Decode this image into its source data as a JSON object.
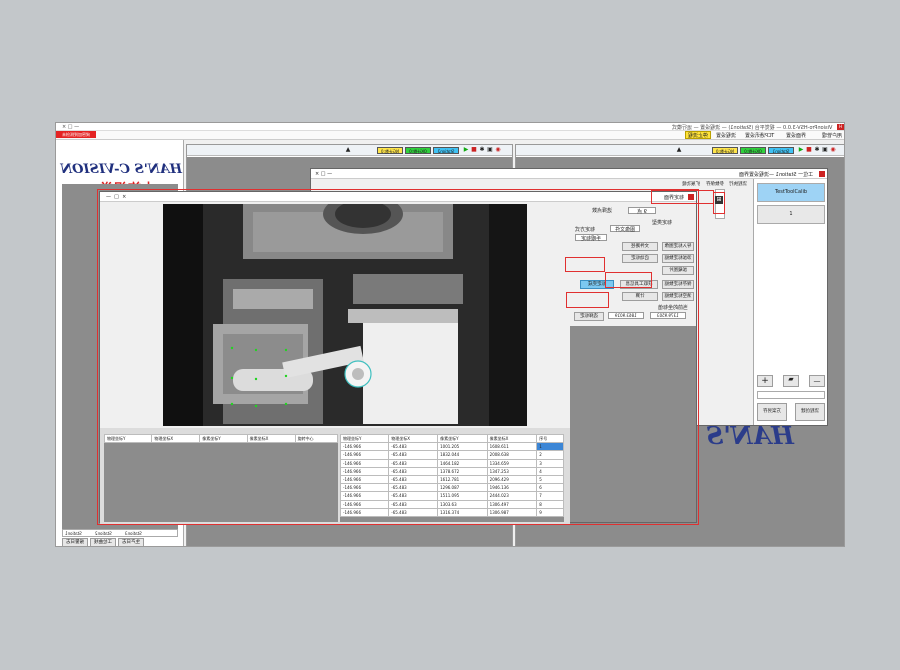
{
  "app": {
    "title": "VisionPro-HSV-3.0.0 — 视觉平台 (Station1) — 流程设置 — 运行模式",
    "window_buttons": [
      "—",
      "□",
      "×"
    ],
    "red_label": "未检测到加密狗",
    "status_yellow": "停止流程",
    "menu": [
      "用户管理",
      "界面设置",
      "TCP通讯设置",
      "流程设置",
      "标定管理"
    ]
  },
  "logo": {
    "line1": "HAN'S C-VISION",
    "line2": "大族视觉"
  },
  "watermark": "HAN'S",
  "station_tabs": [
    {
      "text": "Station1"
    },
    {
      "text": "Station2"
    },
    {
      "text": "Station3"
    }
  ],
  "bottom_buttons": [
    "生产日志",
    "工位曲线",
    "报警日志"
  ],
  "toolbar_left": {
    "ng": "NG计数:0",
    "ok": "OK计数:0",
    "station": "Station2"
  },
  "toolbar_right": {
    "ng": "NG计数:0",
    "ok": "OK计数:0",
    "station": "Station1"
  },
  "flow_dialog": {
    "title": "工位一 Station1 —流程设置界面",
    "tabs": [
      "流程执行",
      "参数保存",
      "扩展功能"
    ],
    "tool_item": "TestToolCalib",
    "tool_index": "1",
    "bottom_btns": [
      "流程创建",
      "方案另存"
    ],
    "nav": {
      "plus": "+",
      "minus": "—"
    }
  },
  "calib_dialog": {
    "title": "标定界面",
    "file_label": "标定方式",
    "file_combo": "图像文件",
    "mode_combo": "手眼标定",
    "calib_label": "标定类型",
    "points_label": "选择点数",
    "points_value": "9 点",
    "buttons": {
      "import_img": "导入标定图像",
      "file_select": "文件路径",
      "auto_calib": "启动标定",
      "load_img": "加载图片",
      "start_mark": "添加标定数据",
      "cut_tool": "获取工具信息",
      "calc": "计算",
      "save_data": "保存标定数据",
      "calib_done": "标定完成",
      "select_clear": "清空标定数据"
    },
    "coords_label": "当前的坐标值",
    "x_val": "1379.9503",
    "y_val": "1863.9019"
  },
  "left_table": {
    "headers": [
      "序号",
      "像素坐标X",
      "像素坐标Y",
      "物理坐标X",
      "物理坐标Y"
    ],
    "rows": [
      [
        "1",
        "1608.611",
        "1001.205",
        "-65.483",
        "-146.966"
      ],
      [
        "2",
        "2008.638",
        "1832.044",
        "-65.483",
        "-146.966"
      ],
      [
        "3",
        "1334.659",
        "1464.182",
        "-65.483",
        "-146.966"
      ],
      [
        "4",
        "1347.253",
        "1378.672",
        "-65.483",
        "-146.966"
      ],
      [
        "5",
        "2096.429",
        "1612.781",
        "-65.483",
        "-146.966"
      ],
      [
        "6",
        "1946.136",
        "1296.087",
        "-65.483",
        "-146.966"
      ],
      [
        "7",
        "2444.023",
        "1511.095",
        "-65.483",
        "-146.966"
      ],
      [
        "8",
        "1306.497",
        "1303.63",
        "-65.483",
        "-146.966"
      ],
      [
        "9",
        "1306.987",
        "1316.374",
        "-65.483",
        "-146.966"
      ]
    ]
  },
  "right_table": {
    "headers": [
      "旋转中心",
      "像素坐标X",
      "像素坐标Y",
      "物理坐标X",
      "物理坐标Y"
    ]
  }
}
